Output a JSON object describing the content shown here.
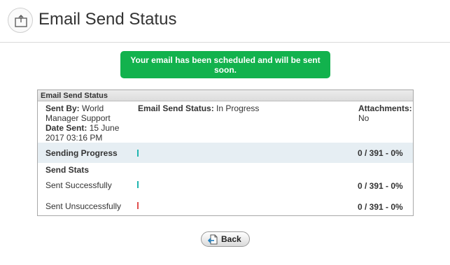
{
  "page": {
    "title": "Email Send Status"
  },
  "notice": {
    "text": "Your email has been scheduled and will be sent soon."
  },
  "panel": {
    "title": "Email Send Status",
    "sent_by_label": "Sent By:",
    "sent_by_value": "World Manager Support",
    "date_sent_label": "Date Sent:",
    "date_sent_value": "15 June 2017 03:16 PM",
    "status_label": "Email Send Status:",
    "status_value": "In Progress",
    "attachments_label": "Attachments:",
    "attachments_value": "No",
    "sending_progress_label": "Sending Progress",
    "sending_progress_value": "0 / 391 - 0%",
    "send_stats_label": "Send Stats",
    "sent_successfully_label": "Sent Successfully",
    "sent_successfully_value": "0 / 391 - 0%",
    "sent_unsuccessfully_label": "Sent Unsuccessfully",
    "sent_unsuccessfully_value": "0 / 391 - 0%"
  },
  "progress": {
    "sending": 0,
    "successful": 0,
    "unsuccessful": 0
  },
  "colors": {
    "notice_bg": "#12b24d",
    "progress_bar": "#1fb5b0",
    "error_bar": "#e0504f",
    "progress_row_bg": "#e6eef3"
  },
  "buttons": {
    "back_label": "Back"
  },
  "icons": {
    "header": "upload-box-icon",
    "back": "back-document-icon"
  }
}
